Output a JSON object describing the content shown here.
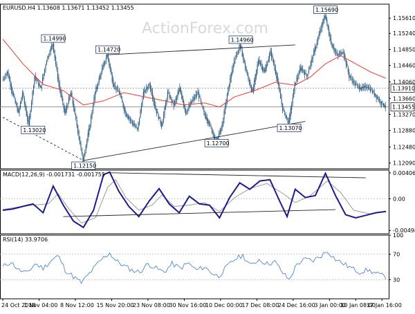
{
  "watermark": "ActionForex.com",
  "colors": {
    "candle": "#2f5e84",
    "ma": "#e8392c",
    "macd": "#1a1a8c",
    "signal": "#9a9a9a",
    "rsi": "#4f87c9",
    "trendline": "#222222",
    "level_line": "#888888",
    "box_fill": "#ffffff",
    "box_border": "#1c3f7a",
    "watermark": "#d9d9d9"
  },
  "chart_data": [
    {
      "panel": "price",
      "type": "candlestick",
      "header": {
        "symbol": "EURUSD.H4",
        "values": [
          "1.13608",
          "1.13671",
          "1.13452",
          "1.13455"
        ]
      },
      "ylim": [
        1.1195,
        1.1595
      ],
      "y_ticks": [
        "1.15610",
        "1.15240",
        "1.14850",
        "1.14460",
        "1.14060",
        "1.13660",
        "1.13270",
        "1.12880",
        "1.12480",
        "1.12090"
      ],
      "x_ticks": [
        "24 Oct 2018",
        "1 Nov 04:00",
        "8 Nov 12:00",
        "15 Nov 20:00",
        "23 Nov 08:00",
        "30 Nov 16:00",
        "10 Dec 00:00",
        "17 Dec 08:00",
        "24 Dec 16:00",
        "3 Jan 00:00",
        "10 Jan 08:00",
        "17 Jan 16:00"
      ],
      "waypoints": [
        [
          0,
          1.141
        ],
        [
          5,
          1.143
        ],
        [
          10,
          1.138
        ],
        [
          16,
          1.133
        ],
        [
          20,
          1.138
        ],
        [
          26,
          1.13
        ],
        [
          32,
          1.142
        ],
        [
          38,
          1.139
        ],
        [
          44,
          1.146
        ],
        [
          50,
          1.1499
        ],
        [
          56,
          1.14
        ],
        [
          62,
          1.133
        ],
        [
          68,
          1.138
        ],
        [
          74,
          1.13
        ],
        [
          80,
          1.1215
        ],
        [
          86,
          1.129
        ],
        [
          92,
          1.138
        ],
        [
          98,
          1.143
        ],
        [
          104,
          1.1472
        ],
        [
          110,
          1.14
        ],
        [
          116,
          1.138
        ],
        [
          122,
          1.133
        ],
        [
          128,
          1.131
        ],
        [
          134,
          1.129
        ],
        [
          140,
          1.138
        ],
        [
          146,
          1.14
        ],
        [
          152,
          1.134
        ],
        [
          158,
          1.13
        ],
        [
          164,
          1.138
        ],
        [
          170,
          1.135
        ],
        [
          176,
          1.139
        ],
        [
          182,
          1.133
        ],
        [
          188,
          1.136
        ],
        [
          194,
          1.138
        ],
        [
          200,
          1.133
        ],
        [
          206,
          1.13
        ],
        [
          212,
          1.126
        ],
        [
          218,
          1.13
        ],
        [
          224,
          1.139
        ],
        [
          230,
          1.146
        ],
        [
          236,
          1.1494
        ],
        [
          242,
          1.143
        ],
        [
          248,
          1.138
        ],
        [
          254,
          1.146
        ],
        [
          260,
          1.143
        ],
        [
          266,
          1.148
        ],
        [
          272,
          1.142
        ],
        [
          278,
          1.134
        ],
        [
          284,
          1.1307
        ],
        [
          290,
          1.14
        ],
        [
          296,
          1.144
        ],
        [
          302,
          1.142
        ],
        [
          308,
          1.147
        ],
        [
          314,
          1.152
        ],
        [
          320,
          1.1569
        ],
        [
          326,
          1.15
        ],
        [
          332,
          1.147
        ],
        [
          338,
          1.148
        ],
        [
          344,
          1.142
        ],
        [
          350,
          1.14
        ],
        [
          356,
          1.139
        ],
        [
          362,
          1.1395
        ],
        [
          368,
          1.138
        ],
        [
          374,
          1.136
        ],
        [
          380,
          1.1346
        ]
      ],
      "ma_points": [
        [
          0,
          1.151
        ],
        [
          20,
          1.145
        ],
        [
          40,
          1.14
        ],
        [
          60,
          1.1385
        ],
        [
          80,
          1.135
        ],
        [
          100,
          1.136
        ],
        [
          120,
          1.138
        ],
        [
          140,
          1.137
        ],
        [
          160,
          1.136
        ],
        [
          180,
          1.135
        ],
        [
          200,
          1.1355
        ],
        [
          215,
          1.1345
        ],
        [
          230,
          1.137
        ],
        [
          250,
          1.1385
        ],
        [
          270,
          1.1405
        ],
        [
          290,
          1.1398
        ],
        [
          305,
          1.1418
        ],
        [
          320,
          1.145
        ],
        [
          335,
          1.147
        ],
        [
          350,
          1.145
        ],
        [
          365,
          1.143
        ],
        [
          380,
          1.1415
        ]
      ],
      "level_lines": [
        {
          "value": 1.1391,
          "label": "1.13910"
        },
        {
          "value": 1.13455,
          "label": "1.13455"
        }
      ],
      "annotations": [
        {
          "label": "1.13020",
          "x": 30,
          "y": 1.1302
        },
        {
          "label": "1.14990",
          "x": 50,
          "y": 1.1499
        },
        {
          "label": "1.12150",
          "x": 80,
          "y": 1.1215
        },
        {
          "label": "1.14720",
          "x": 104,
          "y": 1.1472
        },
        {
          "label": "1.12700",
          "x": 212,
          "y": 1.127
        },
        {
          "label": "1.14960",
          "x": 236,
          "y": 1.1496
        },
        {
          "label": "1.13070",
          "x": 284,
          "y": 1.1307
        },
        {
          "label": "1.15690",
          "x": 320,
          "y": 1.1569
        }
      ],
      "trendlines": [
        {
          "points": [
            [
              104,
              1.1472
            ],
            [
              290,
              1.1496
            ]
          ]
        },
        {
          "points": [
            [
              80,
              1.1215
            ],
            [
              300,
              1.131
            ]
          ]
        },
        {
          "points": [
            [
              0,
              1.132
            ],
            [
              80,
              1.1215
            ]
          ],
          "dashed": true
        }
      ]
    },
    {
      "panel": "macd",
      "type": "line",
      "title": "MACD(12,26,9) -0.001731 -0.001755",
      "ylim": [
        -0.0055,
        0.0045
      ],
      "y_ticks": [
        {
          "value": 0.004069,
          "label": "0.004069"
        },
        {
          "value": 0.0,
          "label": "0.00"
        },
        {
          "value": -0.004981,
          "label": "-0.004981"
        }
      ],
      "series": [
        {
          "key": "macd",
          "points": [
            [
              0,
              -0.0018
            ],
            [
              10,
              -0.0016
            ],
            [
              20,
              -0.0012
            ],
            [
              30,
              -0.0008
            ],
            [
              40,
              -0.0022
            ],
            [
              50,
              0.002
            ],
            [
              60,
              -0.001
            ],
            [
              70,
              -0.0035
            ],
            [
              80,
              -0.0045
            ],
            [
              90,
              -0.0018
            ],
            [
              100,
              0.0038
            ],
            [
              106,
              0.0042
            ],
            [
              115,
              0.0012
            ],
            [
              125,
              -0.0012
            ],
            [
              135,
              -0.0028
            ],
            [
              145,
              -0.0004
            ],
            [
              155,
              0.0016
            ],
            [
              165,
              -0.0008
            ],
            [
              175,
              -0.0022
            ],
            [
              185,
              0.0004
            ],
            [
              195,
              -0.0008
            ],
            [
              205,
              -0.001
            ],
            [
              215,
              -0.003
            ],
            [
              225,
              0.0002
            ],
            [
              235,
              0.0025
            ],
            [
              245,
              0.0015
            ],
            [
              255,
              0.0028
            ],
            [
              265,
              0.003
            ],
            [
              275,
              -0.0005
            ],
            [
              282,
              -0.0028
            ],
            [
              290,
              0.0015
            ],
            [
              300,
              0.0002
            ],
            [
              310,
              0.0005
            ],
            [
              320,
              0.004
            ],
            [
              330,
              0.0005
            ],
            [
              340,
              -0.0025
            ],
            [
              350,
              -0.003
            ],
            [
              360,
              -0.0026
            ],
            [
              370,
              -0.0022
            ],
            [
              380,
              -0.002
            ]
          ]
        },
        {
          "key": "signal",
          "points": [
            [
              0,
              -0.0017
            ],
            [
              15,
              -0.0013
            ],
            [
              30,
              -0.001
            ],
            [
              45,
              -0.0008
            ],
            [
              55,
              0.0008
            ],
            [
              65,
              -0.0015
            ],
            [
              78,
              -0.0038
            ],
            [
              92,
              -0.003
            ],
            [
              104,
              0.0018
            ],
            [
              112,
              0.003
            ],
            [
              122,
              0.0002
            ],
            [
              135,
              -0.0018
            ],
            [
              148,
              -0.001
            ],
            [
              158,
              0.0006
            ],
            [
              170,
              -0.0012
            ],
            [
              185,
              -0.001
            ],
            [
              200,
              -0.0006
            ],
            [
              215,
              -0.002
            ],
            [
              230,
              0.0002
            ],
            [
              245,
              0.0016
            ],
            [
              262,
              0.0024
            ],
            [
              278,
              0.0008
            ],
            [
              290,
              -0.0006
            ],
            [
              305,
              0.0005
            ],
            [
              322,
              0.0028
            ],
            [
              335,
              0.001
            ],
            [
              348,
              -0.0018
            ],
            [
              365,
              -0.0024
            ],
            [
              380,
              -0.002
            ]
          ]
        }
      ],
      "trendlines": [
        {
          "points": [
            [
              104,
              0.0041
            ],
            [
              360,
              0.0033
            ]
          ]
        },
        {
          "points": [
            [
              60,
              -0.0028
            ],
            [
              330,
              -0.0017
            ]
          ]
        }
      ]
    },
    {
      "panel": "rsi",
      "type": "line",
      "title": "RSI(14) 33.9706",
      "ylim": [
        0,
        100
      ],
      "y_ticks": [
        {
          "value": 100,
          "label": "100"
        },
        {
          "value": 70,
          "label": "70"
        },
        {
          "value": 30,
          "label": "30"
        },
        {
          "value": 0,
          "label": "0"
        }
      ],
      "series": [
        {
          "key": "rsi",
          "points": [
            [
              0,
              50
            ],
            [
              8,
              58
            ],
            [
              16,
              45
            ],
            [
              24,
              40
            ],
            [
              32,
              55
            ],
            [
              40,
              48
            ],
            [
              48,
              60
            ],
            [
              55,
              68
            ],
            [
              62,
              45
            ],
            [
              70,
              35
            ],
            [
              78,
              25
            ],
            [
              86,
              40
            ],
            [
              94,
              55
            ],
            [
              100,
              65
            ],
            [
              106,
              72
            ],
            [
              112,
              60
            ],
            [
              120,
              52
            ],
            [
              128,
              45
            ],
            [
              136,
              42
            ],
            [
              144,
              55
            ],
            [
              152,
              48
            ],
            [
              160,
              42
            ],
            [
              168,
              55
            ],
            [
              176,
              48
            ],
            [
              184,
              56
            ],
            [
              192,
              45
            ],
            [
              200,
              50
            ],
            [
              208,
              40
            ],
            [
              214,
              35
            ],
            [
              222,
              50
            ],
            [
              230,
              62
            ],
            [
              238,
              68
            ],
            [
              246,
              52
            ],
            [
              254,
              62
            ],
            [
              262,
              55
            ],
            [
              270,
              58
            ],
            [
              278,
              40
            ],
            [
              284,
              30
            ],
            [
              292,
              55
            ],
            [
              300,
              62
            ],
            [
              308,
              60
            ],
            [
              316,
              68
            ],
            [
              322,
              75
            ],
            [
              330,
              62
            ],
            [
              338,
              55
            ],
            [
              346,
              48
            ],
            [
              354,
              42
            ],
            [
              362,
              45
            ],
            [
              370,
              40
            ],
            [
              380,
              34
            ]
          ]
        }
      ]
    }
  ]
}
